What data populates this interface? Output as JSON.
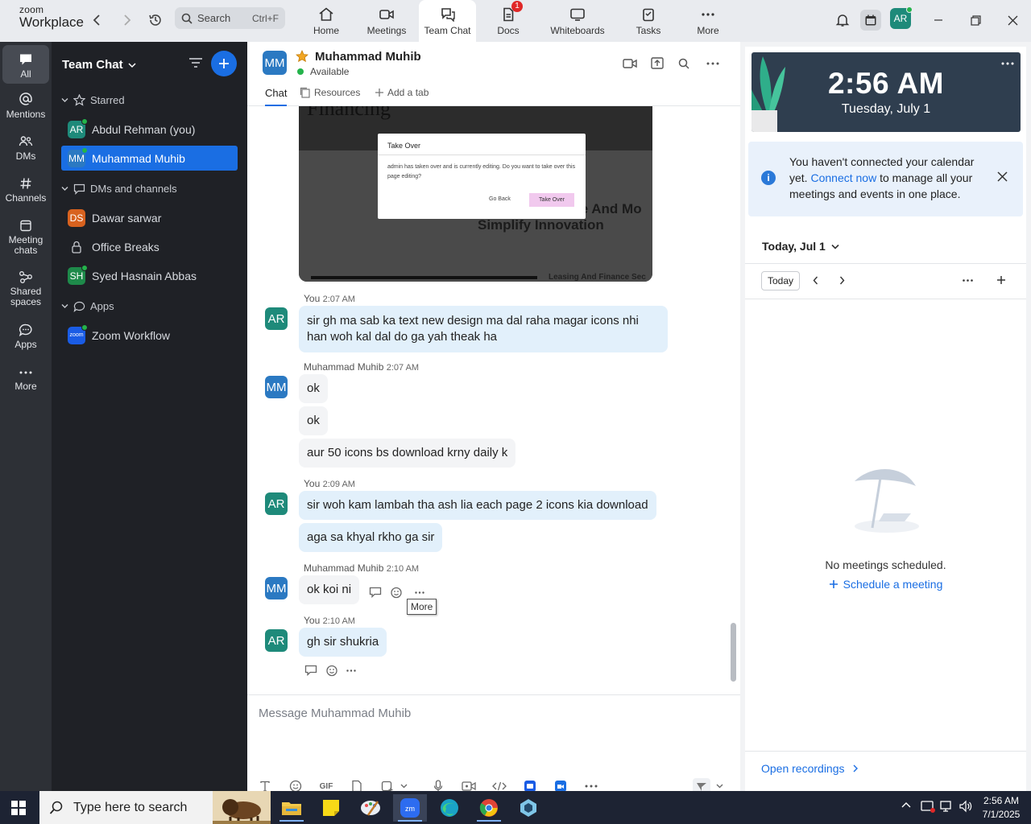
{
  "app": {
    "logo_top": "zoom",
    "logo_bottom": "Workplace",
    "search_label": "Search",
    "search_shortcut": "Ctrl+F",
    "nav_tabs": [
      {
        "label": "Home",
        "icon": "home-icon"
      },
      {
        "label": "Meetings",
        "icon": "video-camera-icon"
      },
      {
        "label": "Team Chat",
        "icon": "chat-bubbles-icon",
        "active": true
      },
      {
        "label": "Docs",
        "icon": "doc-icon",
        "badge": "1"
      },
      {
        "label": "Whiteboards",
        "icon": "whiteboard-icon"
      },
      {
        "label": "Tasks",
        "icon": "tasks-icon"
      },
      {
        "label": "More",
        "icon": "more-dots-icon"
      }
    ],
    "user_avatar": "AR",
    "accent_color": "#1a6ee3"
  },
  "rail": [
    {
      "label": "All",
      "icon": "chat-icon",
      "active": true
    },
    {
      "label": "Mentions",
      "icon": "at-icon"
    },
    {
      "label": "DMs",
      "icon": "people-icon"
    },
    {
      "label": "Channels",
      "icon": "hash-icon"
    },
    {
      "label": "Meeting chats",
      "icon": "calendar-chat-icon"
    },
    {
      "label": "Shared spaces",
      "icon": "shared-spaces-icon"
    },
    {
      "label": "Apps",
      "icon": "apps-chat-icon"
    },
    {
      "label": "More",
      "icon": "more-dots-icon"
    }
  ],
  "sidebar": {
    "title": "Team Chat",
    "sections": {
      "starred": "Starred",
      "dms": "DMs and channels",
      "apps": "Apps"
    },
    "starred_items": [
      {
        "label": "Abdul Rehman (you)",
        "initials": "AR",
        "color": "#1e8a7a"
      },
      {
        "label": "Muhammad Muhib",
        "initials": "MM",
        "color": "#2b79c2"
      }
    ],
    "dm_items": [
      {
        "label": "Dawar sarwar",
        "initials": "DS",
        "color": "#d8621f"
      },
      {
        "label": "Office Breaks",
        "initials": ""
      },
      {
        "label": "Syed Hasnain Abbas",
        "initials": "SH",
        "color": "#1e8a4a"
      }
    ],
    "app_items": [
      {
        "label": "Zoom Workflow",
        "initials": "zoom",
        "color": "#1a5ce5"
      }
    ]
  },
  "chat": {
    "contact_name": "Muhammad Muhib",
    "contact_initials": "MM",
    "status": "Available",
    "tabs": {
      "chat": "Chat",
      "resources": "Resources",
      "add": "Add a tab"
    },
    "preview": {
      "heading_fragment": "Financing",
      "dialog_title": "Take Over",
      "dialog_body": "admin has taken over and is currently editing. Do you want to take over this page editing?",
      "go_back": "Go Back",
      "take_over": "Take Over",
      "bg_text_1": "le And Mo",
      "bg_text_2": "Simplify Innovation",
      "bg_footer": "Leasing And Finance Sec"
    },
    "messages": [
      {
        "sender": "You",
        "initials": "AR",
        "time": "2:07 AM",
        "mine": true,
        "texts": [
          "sir gh ma sab ka text new design ma dal raha magar icons nhi han woh kal dal do ga yah theak ha"
        ]
      },
      {
        "sender": "Muhammad Muhib",
        "initials": "MM",
        "time": "2:07 AM",
        "mine": false,
        "texts": [
          "ok",
          "ok",
          "aur 50 icons bs download krny daily k"
        ]
      },
      {
        "sender": "You",
        "initials": "AR",
        "time": "2:09 AM",
        "mine": true,
        "texts": [
          "sir woh kam lambah tha ash lia each page 2 icons kia download",
          "aga sa khyal rkho ga sir"
        ]
      },
      {
        "sender": "Muhammad Muhib",
        "initials": "MM",
        "time": "2:10 AM",
        "mine": false,
        "texts": [
          "ok koi ni"
        ]
      },
      {
        "sender": "You",
        "initials": "AR",
        "time": "2:10 AM",
        "mine": true,
        "texts": [
          "gh sir shukria"
        ]
      }
    ],
    "tooltip": "More",
    "composer_placeholder": "Message Muhammad Muhib",
    "gif_label": "GIF"
  },
  "right_panel": {
    "time": "2:56 AM",
    "date": "Tuesday, July 1",
    "notice_pre": "You haven't connected your calendar yet.",
    "notice_link": "Connect now",
    "notice_post": "to manage all your meetings and events in one place.",
    "day_header": "Today, Jul 1",
    "today_button": "Today",
    "empty_text": "No meetings scheduled.",
    "schedule_link": "Schedule a meeting",
    "recordings_link": "Open recordings"
  },
  "taskbar": {
    "search_placeholder": "Type here to search",
    "time": "2:56 AM",
    "date": "7/1/2025"
  }
}
